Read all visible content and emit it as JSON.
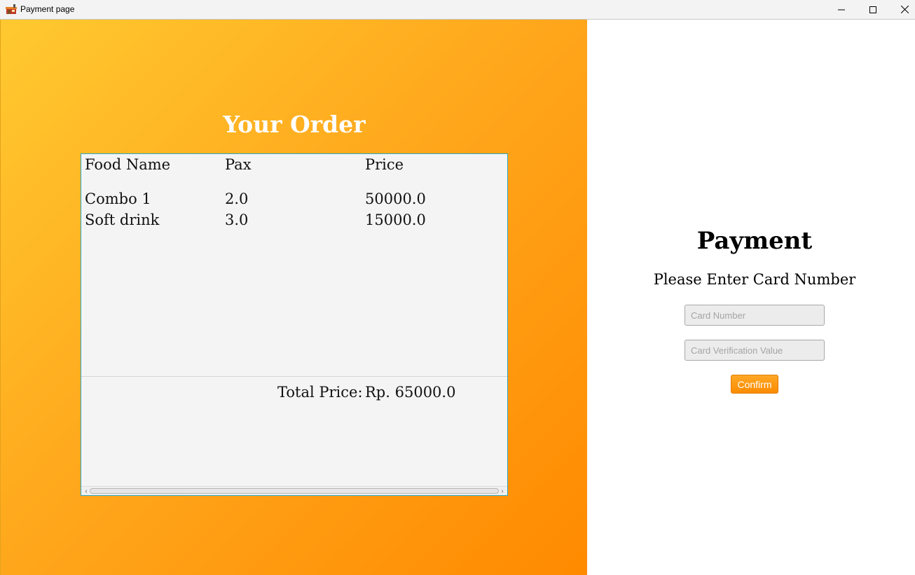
{
  "window": {
    "title": "Payment page",
    "icon": "store-icon",
    "controls": [
      "minimize-icon",
      "maximize-icon",
      "close-icon"
    ]
  },
  "order": {
    "title": "Your Order",
    "headers": [
      "Food Name",
      "Pax",
      "Price"
    ],
    "rows": [
      [
        "Combo 1",
        "2.0",
        "50000.0"
      ],
      [
        "Soft drink",
        "3.0",
        "15000.0"
      ]
    ],
    "total_label": "Total Price:",
    "total_value": "Rp. 65000.0"
  },
  "payment": {
    "title": "Payment",
    "subtitle": "Please Enter Card Number",
    "card_number_placeholder": "Card Number",
    "cvv_placeholder": "Card Verification Value",
    "confirm_label": "Confirm"
  },
  "colors": {
    "gradient_start": "#ffc930",
    "gradient_end": "#ff8a00",
    "button": "#fb8c00",
    "table_border": "#2aa6c4"
  }
}
